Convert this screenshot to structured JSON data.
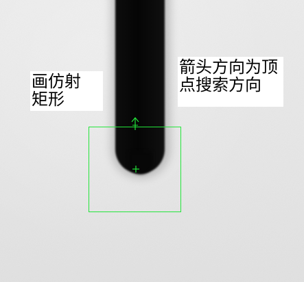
{
  "image": {
    "background_color": "#e9e9e9",
    "probe_color": "#060606",
    "overlay_color": "#23e53a"
  },
  "annotations": {
    "left_text": "画仿射\n矩形",
    "right_text": "箭头方向为顶\n点搜索方向"
  },
  "icons": {
    "arrow": "arrow-up-icon",
    "vertex": "crosshair-plus-icon"
  }
}
